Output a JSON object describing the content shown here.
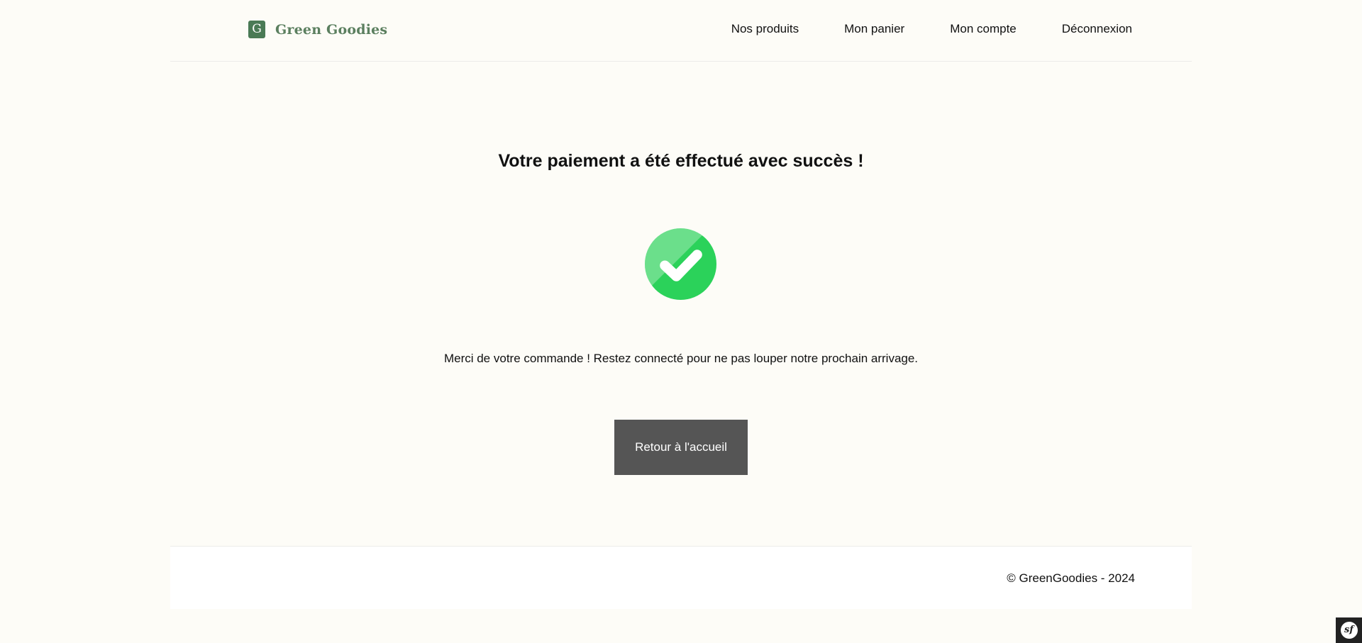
{
  "brand": {
    "logo_letter": "G",
    "name": "Green Goodies",
    "accent_color": "#4a7a55"
  },
  "nav": {
    "items": [
      {
        "label": "Nos produits"
      },
      {
        "label": "Mon panier"
      },
      {
        "label": "Mon compte"
      },
      {
        "label": "Déconnexion"
      }
    ]
  },
  "main": {
    "title": "Votre paiement a été effectué avec succès !",
    "icon": "success-check-icon",
    "message": "Merci de votre commande ! Restez connecté pour ne pas louper notre prochain arrivage.",
    "button_label": "Retour à l'accueil",
    "success_color": "#2bd25a"
  },
  "footer": {
    "copyright": "© GreenGoodies - 2024"
  },
  "debug_toolbar": {
    "icon": "symfony-icon",
    "logo_text": "sf"
  }
}
